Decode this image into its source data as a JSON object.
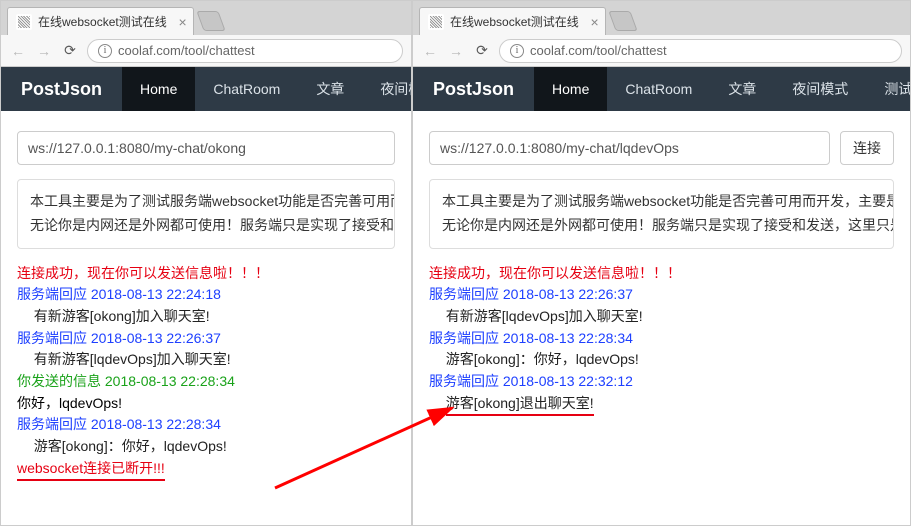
{
  "left": {
    "tab_title": "在线websocket测试在线",
    "url": "coolaf.com/tool/chattest",
    "brand": "PostJson",
    "nav": {
      "home": "Home",
      "chatroom": "ChatRoom",
      "article": "文章",
      "night": "夜间模式"
    },
    "ws_value": "ws://127.0.0.1:8080/my-chat/okong",
    "desc_line1": "本工具主要是为了测试服务端websocket功能是否完善可用而开发",
    "desc_line2": "无论你是内网还是外网都可使用！服务端只是实现了接受和发送",
    "log": {
      "l1": "连接成功，现在你可以发送信息啦！！！",
      "l2": "服务端回应 2018-08-13 22:24:18",
      "l3": "有新游客[okong]加入聊天室!",
      "l4": "服务端回应 2018-08-13 22:26:37",
      "l5": "有新游客[lqdevOps]加入聊天室!",
      "l6": "你发送的信息 2018-08-13 22:28:34",
      "l7": "你好，lqdevOps!",
      "l8": "服务端回应 2018-08-13 22:28:34",
      "l9": "游客[okong]：你好，lqdevOps!",
      "l10": "websocket连接已断开!!!"
    }
  },
  "right": {
    "tab_title": "在线websocket测试在线",
    "url": "coolaf.com/tool/chattest",
    "brand": "PostJson",
    "nav": {
      "home": "Home",
      "chatroom": "ChatRoom",
      "article": "文章",
      "night": "夜间模式",
      "tools": "测试工具"
    },
    "ws_value": "ws://127.0.0.1:8080/my-chat/lqdevOps",
    "connect_btn": "连接",
    "desc_line1": "本工具主要是为了测试服务端websocket功能是否完善可用而开发，主要是相",
    "desc_line2": "无论你是内网还是外网都可使用！服务端只是实现了接受和发送，这里只是测",
    "log": {
      "l1": "连接成功，现在你可以发送信息啦！！！",
      "l2": "服务端回应 2018-08-13 22:26:37",
      "l3": "有新游客[lqdevOps]加入聊天室!",
      "l4": "服务端回应 2018-08-13 22:28:34",
      "l5": "游客[okong]：你好，lqdevOps!",
      "l6": "服务端回应 2018-08-13 22:32:12",
      "l7": "游客[okong]退出聊天室!"
    }
  }
}
